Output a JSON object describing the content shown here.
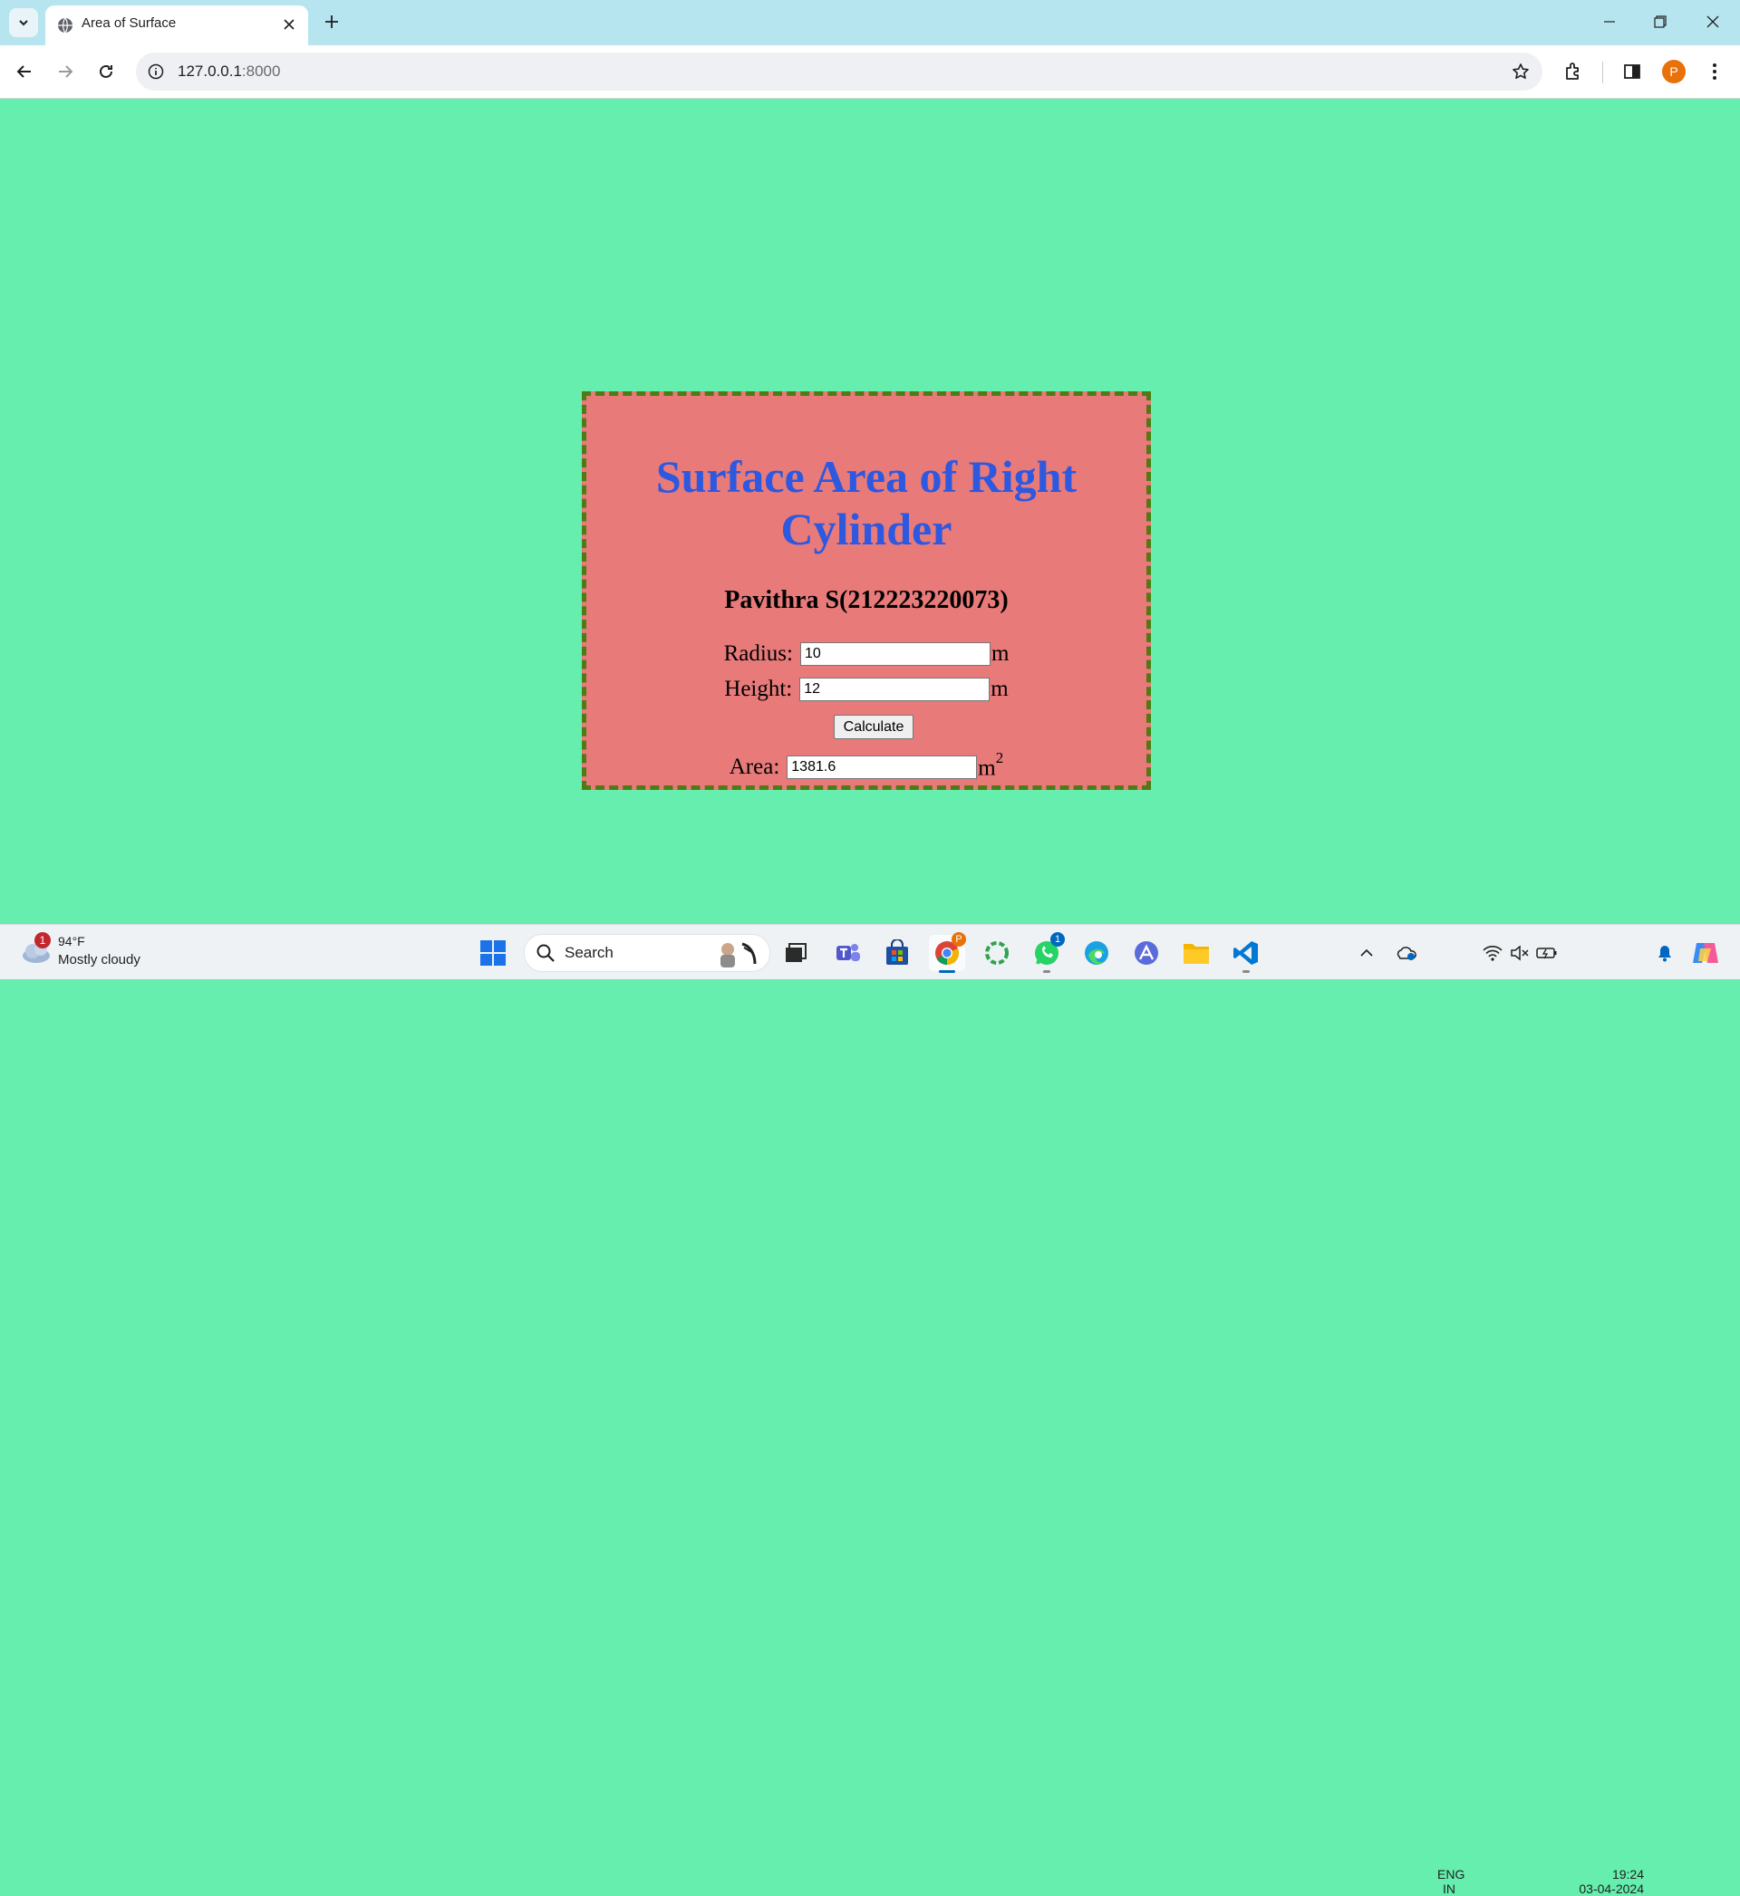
{
  "browser": {
    "tab_title": "Area of Surface",
    "url_host": "127.0.0.1",
    "url_port": ":8000",
    "profile_initial": "P"
  },
  "page": {
    "heading": "Surface Area of Right Cylinder",
    "author": "Pavithra S(212223220073)",
    "radius_label": "Radius:",
    "radius_value": "10",
    "radius_unit": "m",
    "height_label": "Height:",
    "height_value": "12",
    "height_unit": "m",
    "calculate_label": "Calculate",
    "area_label": "Area:",
    "area_value": "1381.6",
    "area_unit": "m",
    "area_unit_exp": "2"
  },
  "taskbar": {
    "weather_temp": "94°F",
    "weather_desc": "Mostly cloudy",
    "weather_badge": "1",
    "search_placeholder": "Search",
    "whatsapp_badge": "1",
    "language_top": "ENG",
    "language_bottom": "IN",
    "time": "19:24",
    "date": "03-04-2024"
  },
  "colors": {
    "page_bg": "#66eeae",
    "card_bg": "#e87a7a",
    "card_border": "#4f7a14",
    "heading": "#2d58e0"
  }
}
